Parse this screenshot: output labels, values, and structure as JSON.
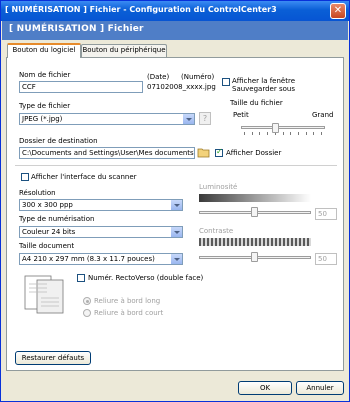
{
  "window": {
    "title": "[ NUMÉRISATION ]   Fichier - Configuration du ControlCenter3",
    "close_glyph": "✕"
  },
  "header": {
    "text": "[ NUMÉRISATION ]   Fichier"
  },
  "tabs": [
    {
      "label": "Bouton du logiciel",
      "active": true
    },
    {
      "label": "Bouton du périphérique",
      "active": false
    }
  ],
  "file": {
    "name_label": "Nom de fichier",
    "name_value": "CCF",
    "date_label": "(Date)",
    "number_label": "(Numéro)",
    "preview_name": "07102008_xxxx.jpg",
    "show_window_label": "Afficher la fenêtre Sauvegarder sous",
    "show_window_checked": false,
    "type_label": "Type de fichier",
    "type_value": "JPEG (*.jpg)",
    "size_label": "Taille du fichier",
    "size_small": "Petit",
    "size_large": "Grand",
    "size_level_percent": 40,
    "dest_label": "Dossier de destination",
    "dest_value": "C:\\Documents and Settings\\User\\Mes documents\\Me",
    "show_folder_label": "Afficher Dossier",
    "show_folder_checked": true
  },
  "scanner": {
    "show_interface_label": "Afficher l'interface du scanner",
    "show_interface_checked": false,
    "resolution_label": "Résolution",
    "resolution_value": "300 x 300 ppp",
    "scan_type_label": "Type de numérisation",
    "scan_type_value": "Couleur 24 bits",
    "doc_size_label": "Taille document",
    "doc_size_value": "A4 210 x 297 mm (8.3 x 11.7 pouces)",
    "brightness_label": "Luminosité",
    "brightness_value": "50",
    "contrast_label": "Contraste",
    "contrast_value": "50",
    "duplex_label": "Numér. RectoVerso (double face)",
    "duplex_checked": false,
    "long_edge_label": "Reliure à bord long",
    "short_edge_label": "Reliure à bord court"
  },
  "buttons": {
    "restore": "Restaurer défauts",
    "ok": "OK",
    "cancel": "Annuler"
  },
  "colors": {
    "titlebar": "#0a5fd6",
    "header_band": "#4f7ec7",
    "active_tab_accent": "#e68b2c"
  }
}
